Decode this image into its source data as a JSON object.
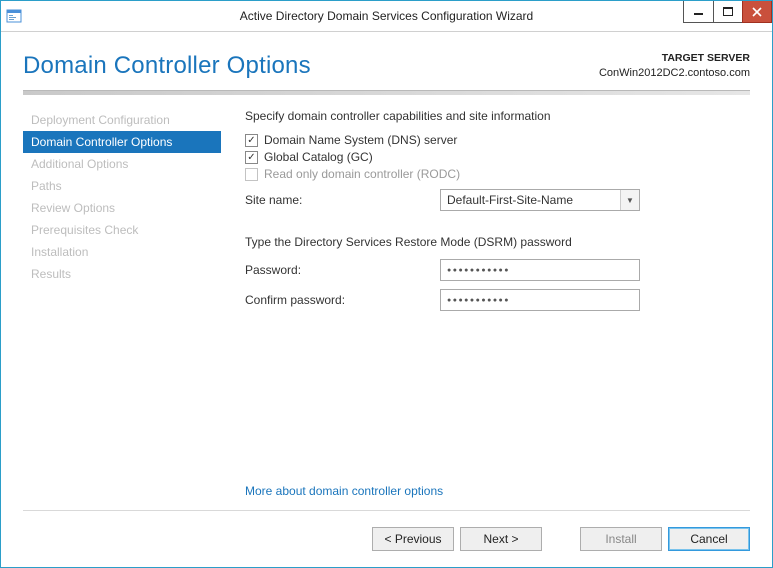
{
  "window": {
    "title": "Active Directory Domain Services Configuration Wizard"
  },
  "header": {
    "page_title": "Domain Controller Options",
    "target_label": "TARGET SERVER",
    "target_server": "ConWin2012DC2.contoso.com"
  },
  "nav": {
    "items": [
      {
        "label": "Deployment Configuration",
        "active": false
      },
      {
        "label": "Domain Controller Options",
        "active": true
      },
      {
        "label": "Additional Options",
        "active": false
      },
      {
        "label": "Paths",
        "active": false
      },
      {
        "label": "Review Options",
        "active": false
      },
      {
        "label": "Prerequisites Check",
        "active": false
      },
      {
        "label": "Installation",
        "active": false
      },
      {
        "label": "Results",
        "active": false
      }
    ]
  },
  "content": {
    "section1_heading": "Specify domain controller capabilities and site information",
    "cb_dns": {
      "label": "Domain Name System (DNS) server",
      "checked": true,
      "enabled": true
    },
    "cb_gc": {
      "label": "Global Catalog (GC)",
      "checked": true,
      "enabled": true
    },
    "cb_rodc": {
      "label": "Read only domain controller (RODC)",
      "checked": false,
      "enabled": false
    },
    "site_label": "Site name:",
    "site_value": "Default-First-Site-Name",
    "section2_heading": "Type the Directory Services Restore Mode (DSRM) password",
    "pwd_label": "Password:",
    "pwd_value": "●●●●●●●●●●●",
    "confirm_label": "Confirm password:",
    "confirm_value": "●●●●●●●●●●●",
    "more_link": "More about domain controller options"
  },
  "footer": {
    "previous": "< Previous",
    "next": "Next >",
    "install": "Install",
    "cancel": "Cancel"
  }
}
